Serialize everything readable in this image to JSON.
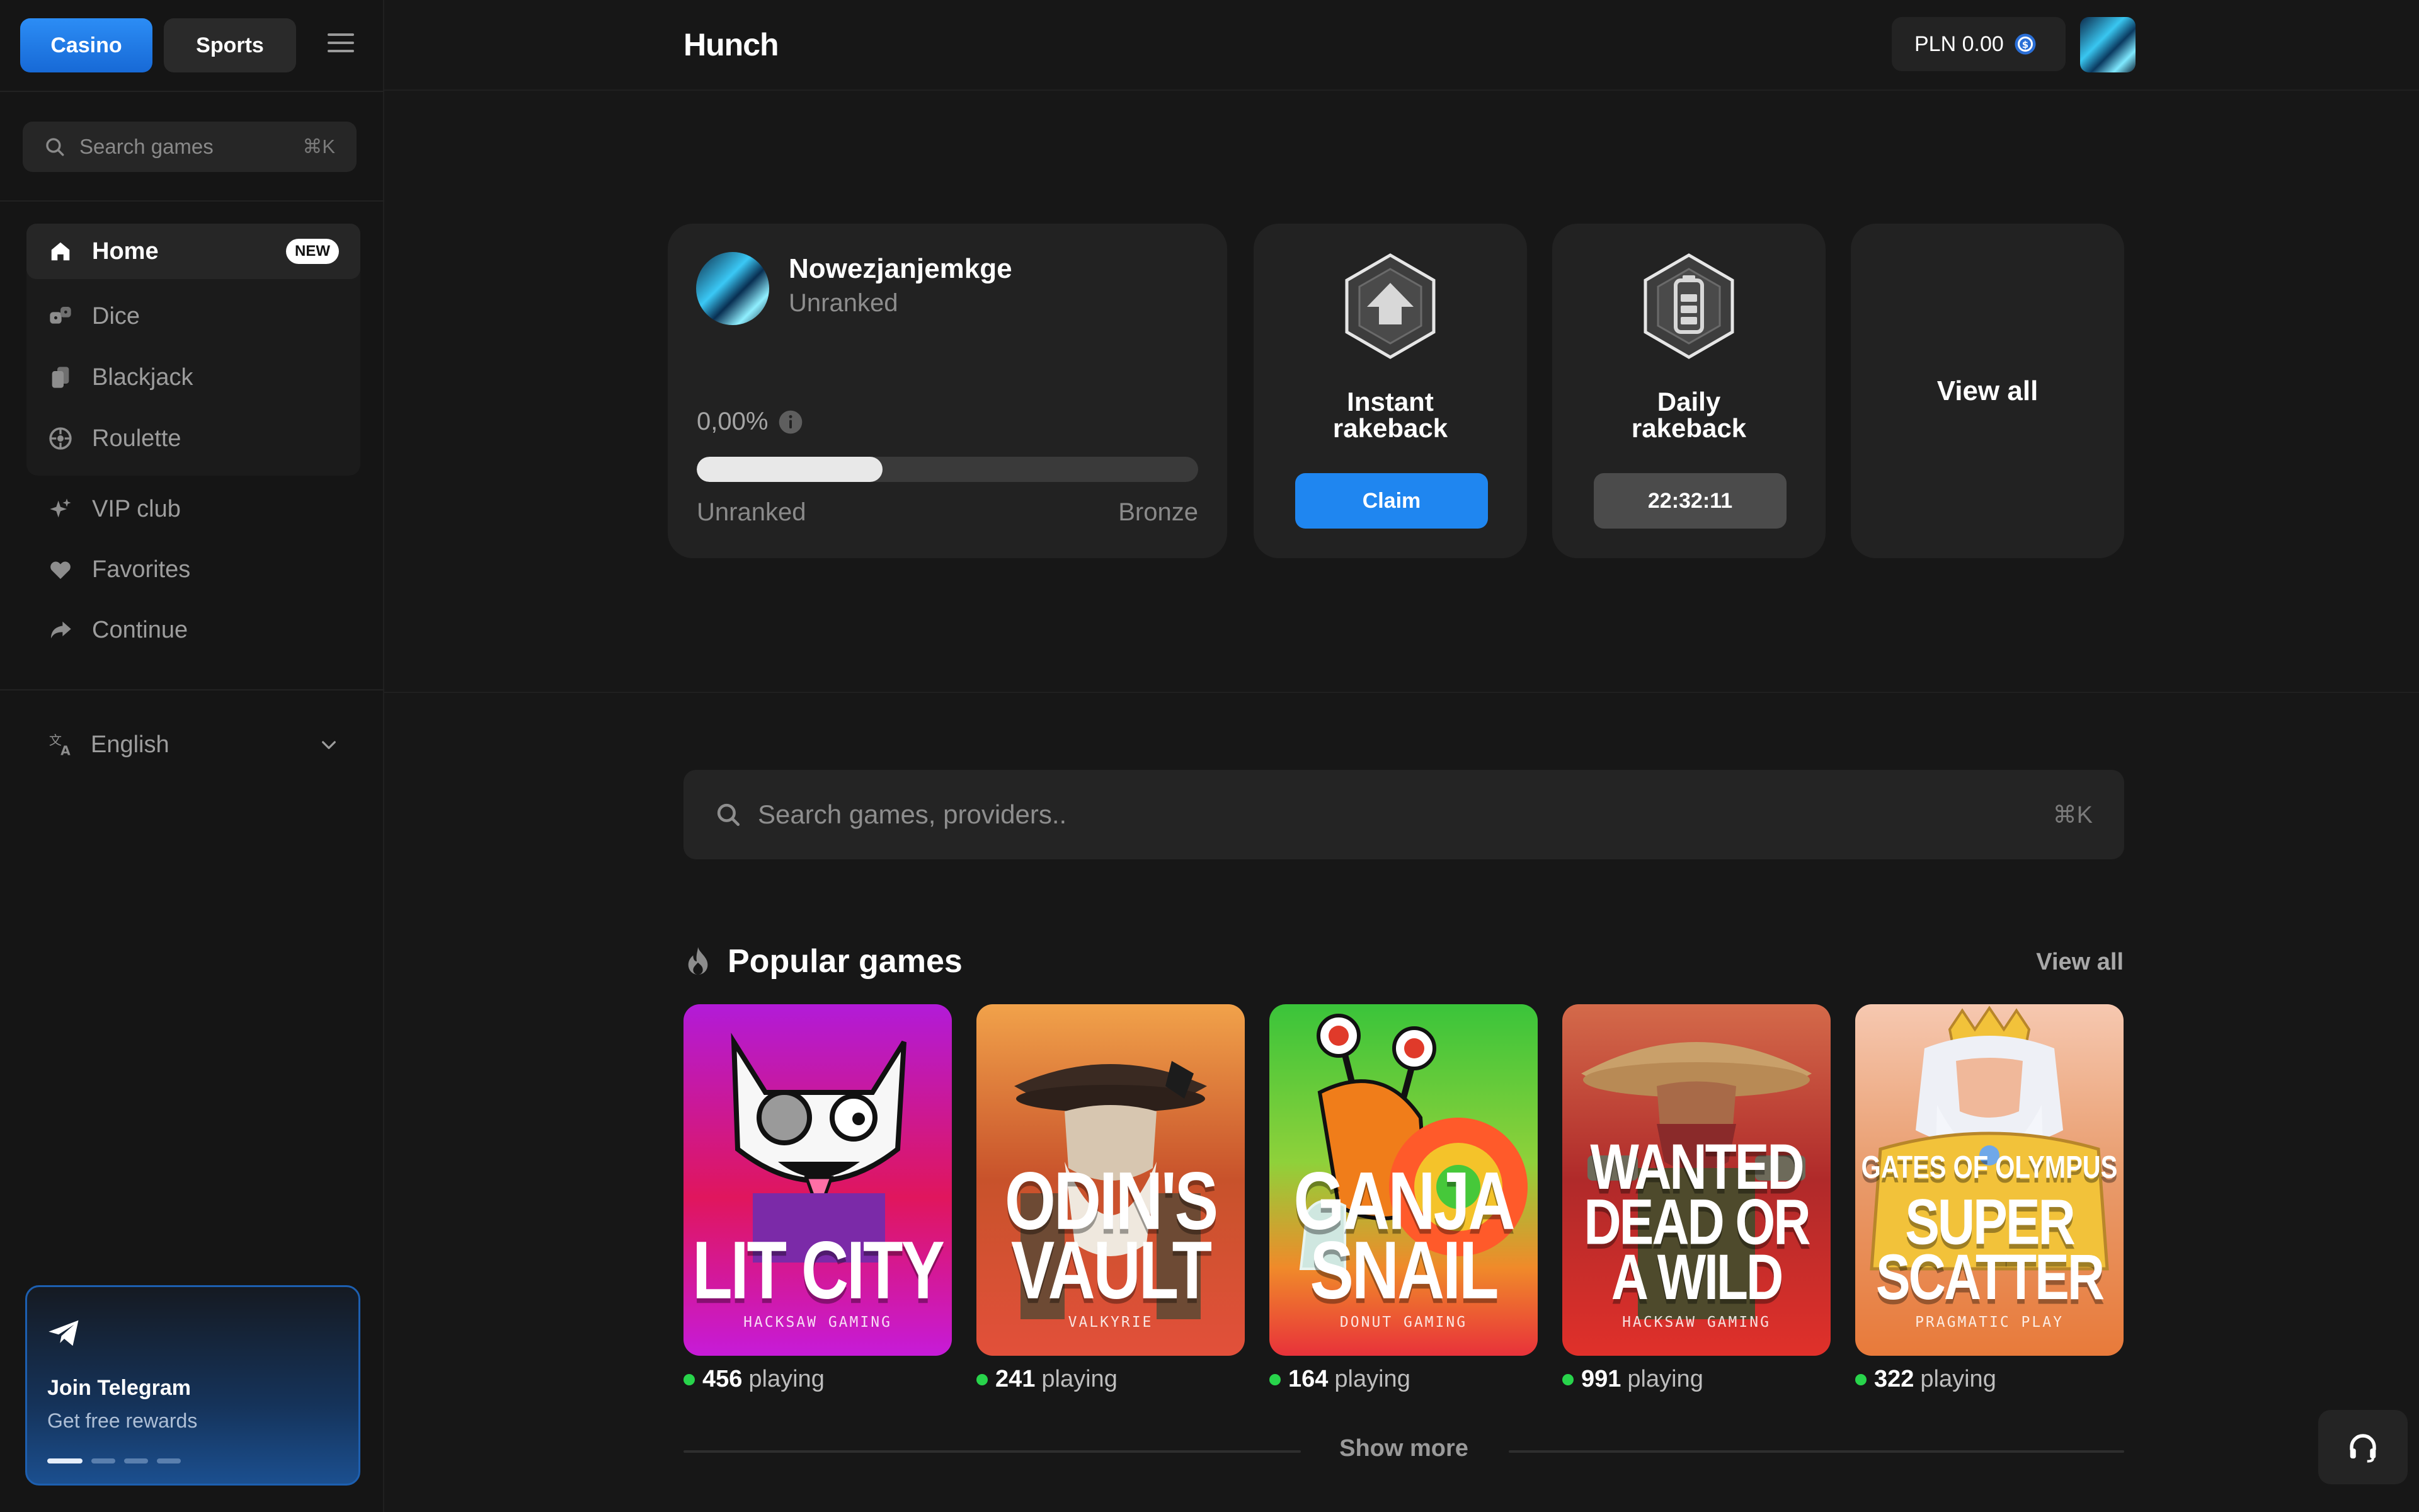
{
  "sidebar": {
    "mode_casino": "Casino",
    "mode_sports": "Sports",
    "search": {
      "placeholder": "Search games",
      "shortcut": "⌘K"
    },
    "nav": [
      {
        "label": "Home",
        "badge": "NEW",
        "icon": "home-icon",
        "active": true
      },
      {
        "label": "Dice",
        "icon": "dice-icon"
      },
      {
        "label": "Blackjack",
        "icon": "cards-icon"
      },
      {
        "label": "Roulette",
        "icon": "roulette-icon"
      },
      {
        "label": "VIP club",
        "icon": "sparkle-icon"
      },
      {
        "label": "Favorites",
        "icon": "heart-icon"
      },
      {
        "label": "Continue",
        "icon": "share-arrow-icon"
      }
    ],
    "language": "English",
    "telegram": {
      "title": "Join Telegram",
      "subtitle": "Get free rewards",
      "icon": "telegram-plane-icon"
    }
  },
  "topbar": {
    "brand": "Hunch",
    "balance": "PLN 0.00",
    "balance_icon": "coin-icon"
  },
  "profile": {
    "username": "Nowezjanjemkge",
    "rank": "Unranked",
    "progress_text": "0,00%",
    "progress_fraction": 0.37,
    "from_rank": "Unranked",
    "to_rank": "Bronze"
  },
  "rakeback": {
    "instant": {
      "title_line1": "Instant",
      "title_line2": "rakeback",
      "button": "Claim",
      "icon": "upload-hex-icon"
    },
    "daily": {
      "title_line1": "Daily",
      "title_line2": "rakeback",
      "timer": "22:32:11",
      "icon": "battery-hex-icon"
    },
    "view_all": "View all"
  },
  "main_search": {
    "placeholder": "Search games, providers..",
    "shortcut": "⌘K"
  },
  "popular": {
    "title": "Popular games",
    "view_all": "View all",
    "show_more": "Show more",
    "games": [
      {
        "title": "LIT CITY",
        "provider": "HACKSAW GAMING",
        "count": "456",
        "suffix": "playing"
      },
      {
        "title_line1": "ODIN'S",
        "title_line2": "VAULT",
        "provider": "VALKYRIE",
        "count": "241",
        "suffix": "playing"
      },
      {
        "title_line1": "GANJA",
        "title_line2": "SNAIL",
        "provider": "DONUT GAMING",
        "count": "164",
        "suffix": "playing"
      },
      {
        "title_line1": "WANTED",
        "title_line2": "DEAD OR",
        "title_line3": "A WILD",
        "provider": "HACKSAW GAMING",
        "count": "991",
        "suffix": "playing"
      },
      {
        "title_line0": "GATES OF OLYMPUS",
        "title_line1": "SUPER",
        "title_line2": "SCATTER",
        "provider": "PRAGMATIC PLAY",
        "count": "322",
        "suffix": "playing"
      }
    ]
  },
  "colors": {
    "accent": "#1f86f0",
    "online": "#28d44b",
    "background": "#171717"
  }
}
